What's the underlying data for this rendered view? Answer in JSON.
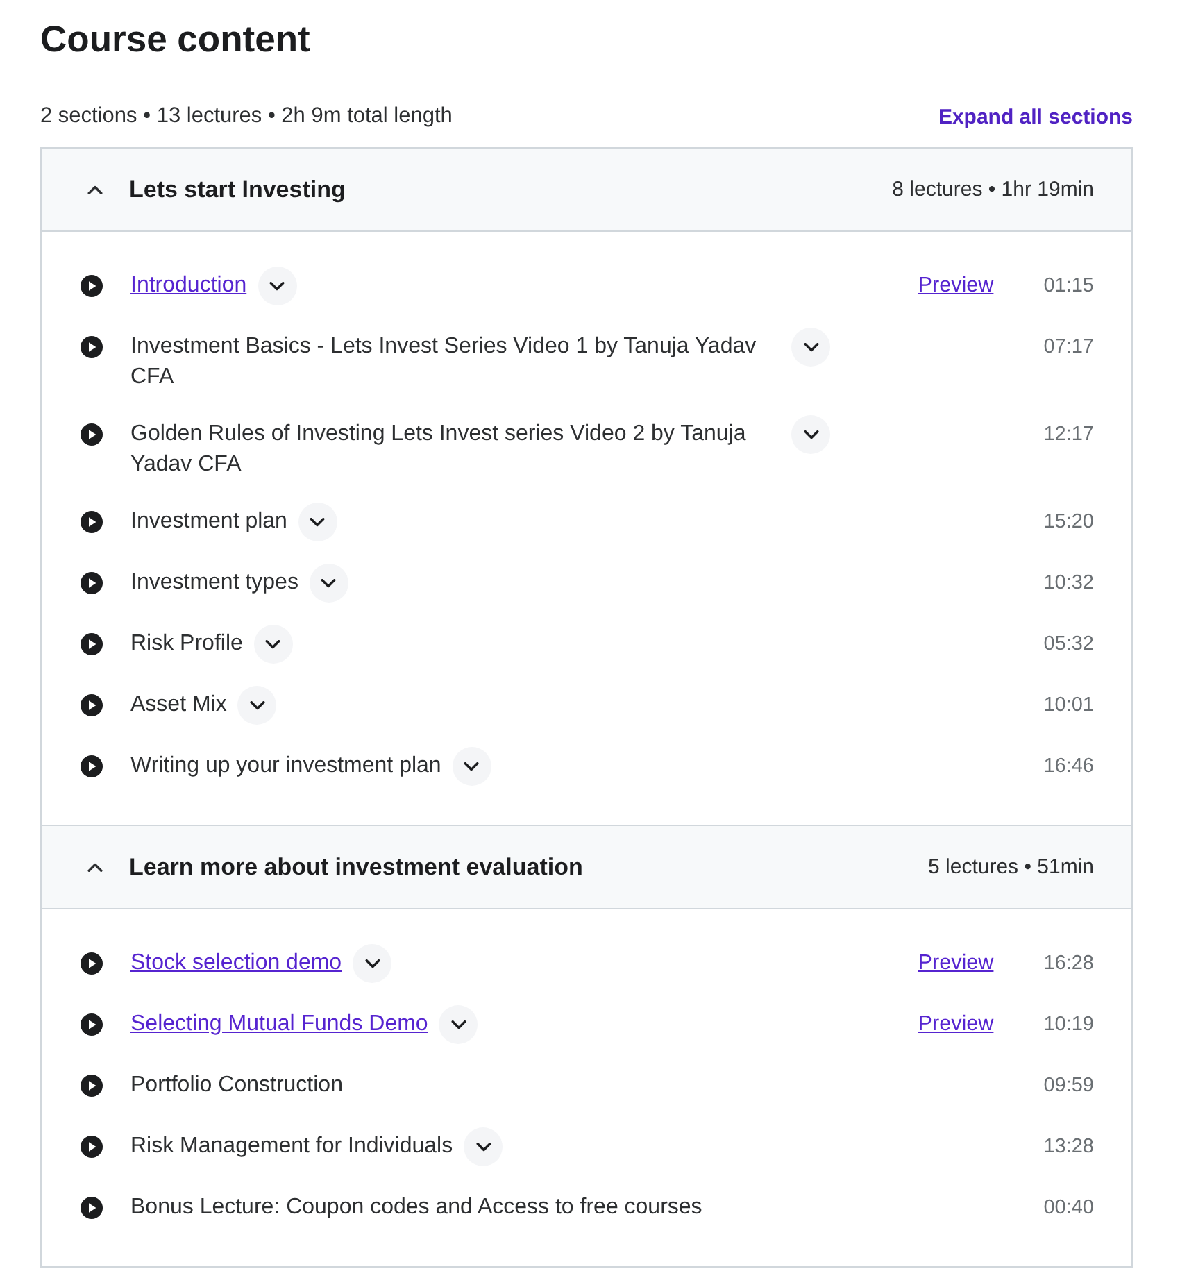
{
  "heading": "Course content",
  "summary": "2 sections • 13 lectures • 2h 9m total length",
  "expand_all": "Expand all sections",
  "sections": [
    {
      "title": "Lets start Investing",
      "meta": "8 lectures • 1hr 19min",
      "expanded": true,
      "lectures": [
        {
          "title": "Introduction",
          "linked": true,
          "has_details": true,
          "preview": "Preview",
          "duration": "01:15"
        },
        {
          "title": "Investment Basics - Lets Invest Series Video 1 by Tanuja Yadav CFA",
          "linked": false,
          "has_details": true,
          "duration": "07:17"
        },
        {
          "title": "Golden Rules of Investing Lets Invest series Video 2 by Tanuja Yadav CFA",
          "linked": false,
          "has_details": true,
          "duration": "12:17"
        },
        {
          "title": "Investment plan",
          "linked": false,
          "has_details": true,
          "duration": "15:20"
        },
        {
          "title": "Investment types",
          "linked": false,
          "has_details": true,
          "duration": "10:32"
        },
        {
          "title": "Risk Profile",
          "linked": false,
          "has_details": true,
          "duration": "05:32"
        },
        {
          "title": "Asset Mix",
          "linked": false,
          "has_details": true,
          "duration": "10:01"
        },
        {
          "title": "Writing up your investment plan",
          "linked": false,
          "has_details": true,
          "duration": "16:46"
        }
      ]
    },
    {
      "title": "Learn more about investment evaluation",
      "meta": "5 lectures • 51min",
      "expanded": true,
      "lectures": [
        {
          "title": "Stock selection demo",
          "linked": true,
          "has_details": true,
          "preview": "Preview",
          "duration": "16:28"
        },
        {
          "title": "Selecting Mutual Funds Demo",
          "linked": true,
          "has_details": true,
          "preview": "Preview",
          "duration": "10:19"
        },
        {
          "title": "Portfolio Construction",
          "linked": false,
          "has_details": false,
          "duration": "09:59"
        },
        {
          "title": "Risk Management for Individuals",
          "linked": false,
          "has_details": true,
          "duration": "13:28"
        },
        {
          "title": "Bonus Lecture: Coupon codes and Access to free courses",
          "linked": false,
          "has_details": false,
          "duration": "00:40"
        }
      ]
    }
  ]
}
